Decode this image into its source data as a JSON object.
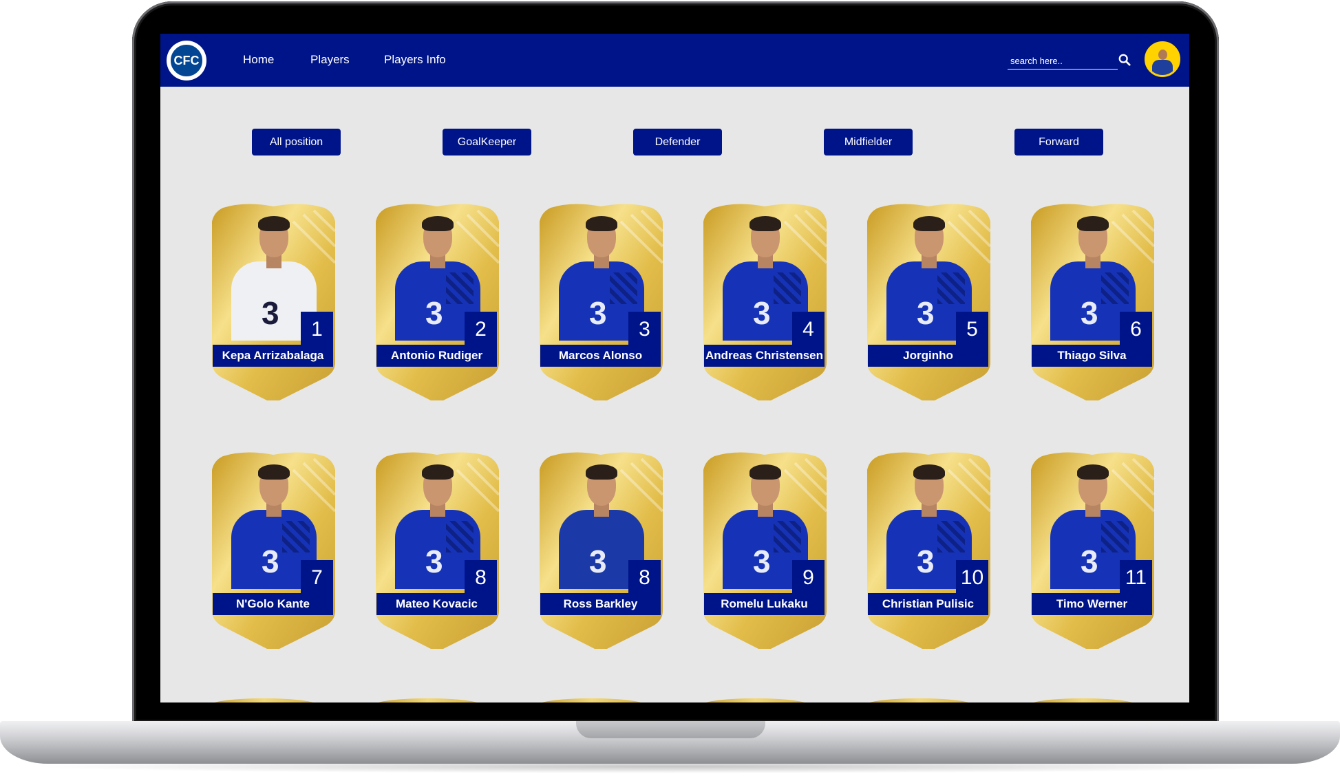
{
  "nav": {
    "logo_text": "CFC",
    "links": [
      "Home",
      "Players",
      "Players Info"
    ],
    "search_placeholder": "search here.."
  },
  "filters": [
    "All position",
    "GoalKeeper",
    "Defender",
    "Midfielder",
    "Forward"
  ],
  "players": [
    {
      "name": "Kepa Arrizabalaga",
      "number": "1"
    },
    {
      "name": "Antonio Rudiger",
      "number": "2"
    },
    {
      "name": "Marcos Alonso",
      "number": "3"
    },
    {
      "name": "Andreas Christensen",
      "number": "4"
    },
    {
      "name": "Jorginho",
      "number": "5"
    },
    {
      "name": "Thiago Silva",
      "number": "6"
    },
    {
      "name": "N'Golo Kante",
      "number": "7"
    },
    {
      "name": "Mateo Kovacic",
      "number": "8"
    },
    {
      "name": "Ross Barkley",
      "number": "8"
    },
    {
      "name": "Romelu Lukaku",
      "number": "9"
    },
    {
      "name": "Christian Pulisic",
      "number": "10"
    },
    {
      "name": "Timo Werner",
      "number": "11"
    }
  ],
  "colors": {
    "navbar": "#001489",
    "page_bg": "#e7e7e7",
    "card_gold": "#e8c85a"
  }
}
